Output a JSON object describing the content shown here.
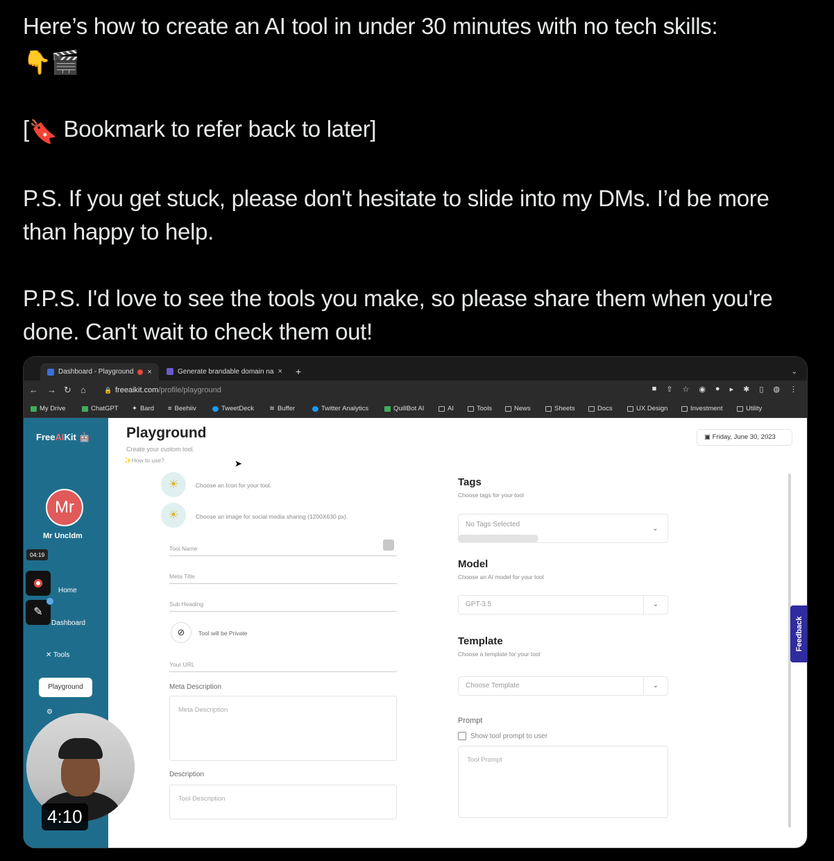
{
  "tweet": {
    "line1": "Here’s how to create an AI tool in under 30 minutes with no tech skills:",
    "emojis": "👇🎬",
    "bookmark_open": "[",
    "bookmark_emoji": "🔖",
    "bookmark_text": " Bookmark to refer back to later]",
    "ps": "P.S. If you get stuck, please don't hesitate to slide into my DMs. I’d be more than happy to help.",
    "pps": "P.P.S. I'd love to see the tools you make, so please share them when you're done. Can't wait to check them out!"
  },
  "browser": {
    "tabs": [
      {
        "label": "Dashboard - Playground",
        "close": "×"
      },
      {
        "label": "Generate brandable domain na",
        "close": "×"
      }
    ],
    "new_tab": "+",
    "url_host": "freeaikit.com",
    "url_path": "/profile/playground",
    "bookmarks": [
      "My Drive",
      "ChatGPT",
      "Bard",
      "Beehiiv",
      "TweetDeck",
      "Buffer",
      "Twitter Analytics",
      "QuillBot AI",
      "AI",
      "Tools",
      "News",
      "Sheets",
      "Docs",
      "UX Design",
      "Investment",
      "Utility"
    ]
  },
  "sidebar": {
    "logo_prefix": "Free",
    "logo_ai": "AI",
    "logo_suffix": "Kit",
    "avatar_initials": "Mr",
    "username": "Mr Uncldm",
    "recording_time": "04:19",
    "items": {
      "home": "Home",
      "dashboard": "Dashboard",
      "tools": "Tools",
      "playground": "Playground"
    }
  },
  "main": {
    "title": "Playground",
    "subtitle": "Create your custom tool.",
    "howto": "✨How to use?",
    "date": "Friday, June 30, 2023",
    "choose_icon": "Choose an Icon for your tool.",
    "choose_image": "Choose an image for social media sharing (1200X630 px).",
    "fields": {
      "tool_name": "Tool Name",
      "meta_title": "Meta Title",
      "sub_heading": "Sub Heading",
      "private": "Tool will be Private",
      "your_url": "Your URL",
      "meta_description_label": "Meta Description",
      "meta_description_placeholder": "Meta Description",
      "description_label": "Description",
      "description_placeholder": "Tool Description"
    },
    "right": {
      "tags_heading": "Tags",
      "tags_sub": "Choose tags for your tool",
      "tags_value": "No Tags Selected",
      "model_heading": "Model",
      "model_sub": "Choose an AI model for your tool",
      "model_value": "GPT-3.5",
      "template_heading": "Template",
      "template_sub": "Choose a template for your tool",
      "template_value": "Choose Template",
      "prompt_label": "Prompt",
      "show_prompt": "Show tool prompt to user",
      "prompt_placeholder": "Tool Prompt"
    },
    "feedback": "Feedback"
  },
  "video": {
    "duration": "4:10"
  }
}
